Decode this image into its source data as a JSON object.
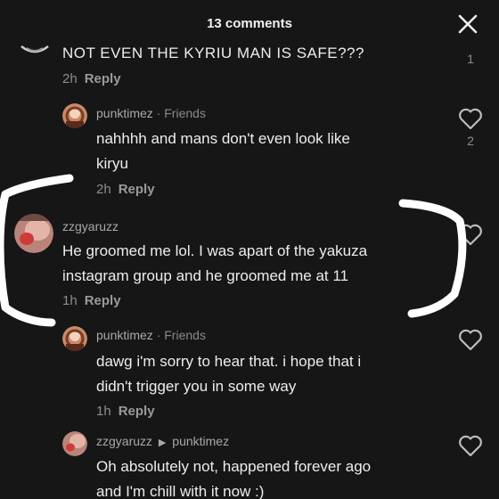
{
  "header": {
    "title": "13 comments"
  },
  "comments": [
    {
      "text": "NOT EVEN THE KYRIU MAN IS SAFE???",
      "time": "2h",
      "reply_label": "Reply",
      "likes": "1"
    },
    {
      "username": "punktimez",
      "tag": "· Friends",
      "line1": "nahhhh and mans don't even look like",
      "line2": "kiryu",
      "time": "2h",
      "reply_label": "Reply",
      "likes": "2"
    },
    {
      "username": "zzgyaruzz",
      "line1": "He groomed me lol. I was apart of the yakuza",
      "line2": "instagram group and he groomed me at 11",
      "time": "1h",
      "reply_label": "Reply"
    },
    {
      "username": "punktimez",
      "tag": "· Friends",
      "line1": "dawg i'm sorry to hear that. i hope that i",
      "line2": "didn't trigger you in some way",
      "time": "1h",
      "reply_label": "Reply"
    },
    {
      "username": "zzgyaruzz",
      "reply_to": "punktimez",
      "line1": "Oh absolutely not, happened forever ago",
      "line2": "and I'm chill with it now :)"
    }
  ],
  "colors": {
    "background": "#161616",
    "text": "#ededed",
    "muted": "#8d8d8d",
    "scribble": "#ffffff"
  },
  "icons": {
    "close": "close-icon",
    "like": "heart-outline-icon",
    "reply_arrow": "reply-arrow-icon"
  }
}
